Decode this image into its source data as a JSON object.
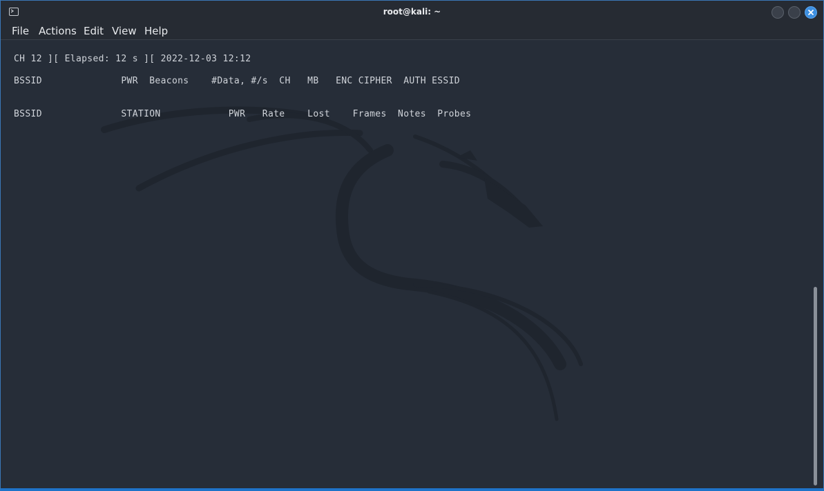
{
  "window": {
    "title": "root@kali: ~",
    "icon": "terminal-icon"
  },
  "menubar": {
    "items": [
      "File",
      "Actions",
      "Edit",
      "View",
      "Help"
    ]
  },
  "terminal": {
    "lines": [
      "CH 12 ][ Elapsed: 12 s ][ 2022-12-03 12:12",
      "BSSID              PWR  Beacons    #Data, #/s  CH   MB   ENC CIPHER  AUTH ESSID",
      "BSSID              STATION            PWR   Rate    Lost    Frames  Notes  Probes"
    ],
    "background_image": "kali-dragon-logo"
  },
  "colors": {
    "terminal_bg": "#262d38",
    "text": "#d0d4da",
    "accent": "#3d8fe0"
  }
}
